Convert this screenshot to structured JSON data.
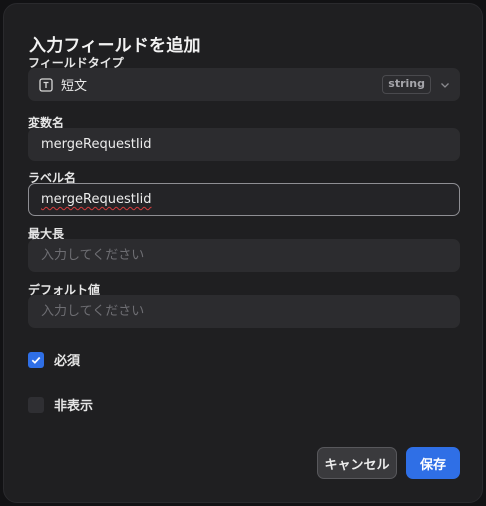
{
  "dialog": {
    "title": "入力フィールドを追加"
  },
  "field_type": {
    "label": "フィールドタイプ",
    "selected": "短文",
    "badge": "string",
    "icon": "text-field-icon"
  },
  "variable_name": {
    "label": "変数名",
    "value": "mergeRequestIid"
  },
  "label_name": {
    "label": "ラベル名",
    "value": "mergeRequestIid"
  },
  "max_length": {
    "label": "最大長",
    "placeholder": "入力してください",
    "value": ""
  },
  "default_value": {
    "label": "デフォルト値",
    "placeholder": "入力してください",
    "value": ""
  },
  "options": {
    "required_label": "必須",
    "required_checked": true,
    "hidden_label": "非表示",
    "hidden_checked": false
  },
  "buttons": {
    "cancel": "キャンセル",
    "save": "保存"
  },
  "colors": {
    "accent": "#2f6fe6",
    "background": "#1f1f21",
    "field": "#2c2c2f"
  }
}
